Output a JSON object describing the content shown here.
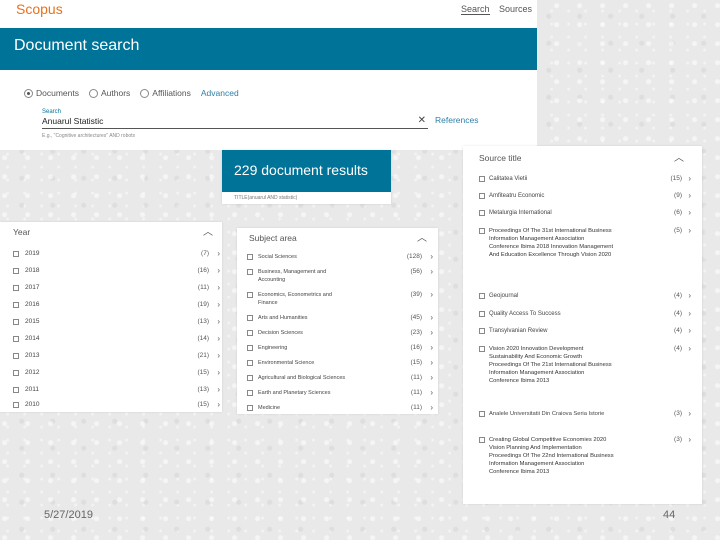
{
  "header": {
    "brand": "Scopus",
    "nav": [
      "Search",
      "Sources"
    ],
    "banner_title": "Document search"
  },
  "search": {
    "radios": [
      {
        "label": "Documents",
        "selected": true
      },
      {
        "label": "Authors",
        "selected": false
      },
      {
        "label": "Affiliations",
        "selected": false
      }
    ],
    "advanced_label": "Advanced",
    "field_label": "Search",
    "value": "Anuarul Statistic",
    "hint": "E.g., \"Cognitive architectures\" AND robots",
    "references_label": "References"
  },
  "results": {
    "count_text": "229 document results",
    "query_text": "TITLE(anuarul AND statistic)"
  },
  "year_facet": {
    "title": "Year",
    "items": [
      {
        "label": "2019",
        "count": "(7)"
      },
      {
        "label": "2018",
        "count": "(16)"
      },
      {
        "label": "2017",
        "count": "(11)"
      },
      {
        "label": "2016",
        "count": "(19)"
      },
      {
        "label": "2015",
        "count": "(13)"
      },
      {
        "label": "2014",
        "count": "(14)"
      },
      {
        "label": "2013",
        "count": "(21)"
      },
      {
        "label": "2012",
        "count": "(15)"
      },
      {
        "label": "2011",
        "count": "(13)"
      },
      {
        "label": "2010",
        "count": "(15)"
      }
    ]
  },
  "subject_facet": {
    "title": "Subject area",
    "items": [
      {
        "label": "Social Sciences",
        "count": "(128)"
      },
      {
        "label": "Business, Management and Accounting",
        "count": "(56)"
      },
      {
        "label": "Economics, Econometrics and Finance",
        "count": "(39)"
      },
      {
        "label": "Arts and Humanities",
        "count": "(45)"
      },
      {
        "label": "Decision Sciences",
        "count": "(23)"
      },
      {
        "label": "Engineering",
        "count": "(16)"
      },
      {
        "label": "Environmental Science",
        "count": "(15)"
      },
      {
        "label": "Agricultural and Biological Sciences",
        "count": "(11)"
      },
      {
        "label": "Earth and Planetary Sciences",
        "count": "(11)"
      },
      {
        "label": "Medicine",
        "count": "(11)"
      }
    ]
  },
  "source_facet": {
    "title": "Source title",
    "items": [
      {
        "label": "Calitatea Vietii",
        "count": "(15)"
      },
      {
        "label": "Amfiteatru Economic",
        "count": "(9)"
      },
      {
        "label": "Metalurgia International",
        "count": "(6)"
      },
      {
        "label": "Proceedings Of The 31st International Business Information Management Association Conference Ibima 2018 Innovation Management And Education Excellence Through Vision 2020",
        "count": "(5)"
      },
      {
        "label": "Geojournal",
        "count": "(4)"
      },
      {
        "label": "Quality Access To Success",
        "count": "(4)"
      },
      {
        "label": "Transylvanian Review",
        "count": "(4)"
      },
      {
        "label": "Vision 2020 Innovation Development Sustainability And Economic Growth Proceedings Of The 21st International Business Information Management Association Conference Ibima 2013",
        "count": "(4)"
      },
      {
        "label": "Analele Universitatii Din Craiova Seria Istorie",
        "count": "(3)"
      },
      {
        "label": "Creating Global Competitive Economies 2020 Vision Planning And Implementation Proceedings Of The 22nd International Business Information Management Association Conference Ibima 2013",
        "count": "(3)"
      }
    ]
  },
  "footer": {
    "date": "5/27/2019",
    "page": "44"
  }
}
